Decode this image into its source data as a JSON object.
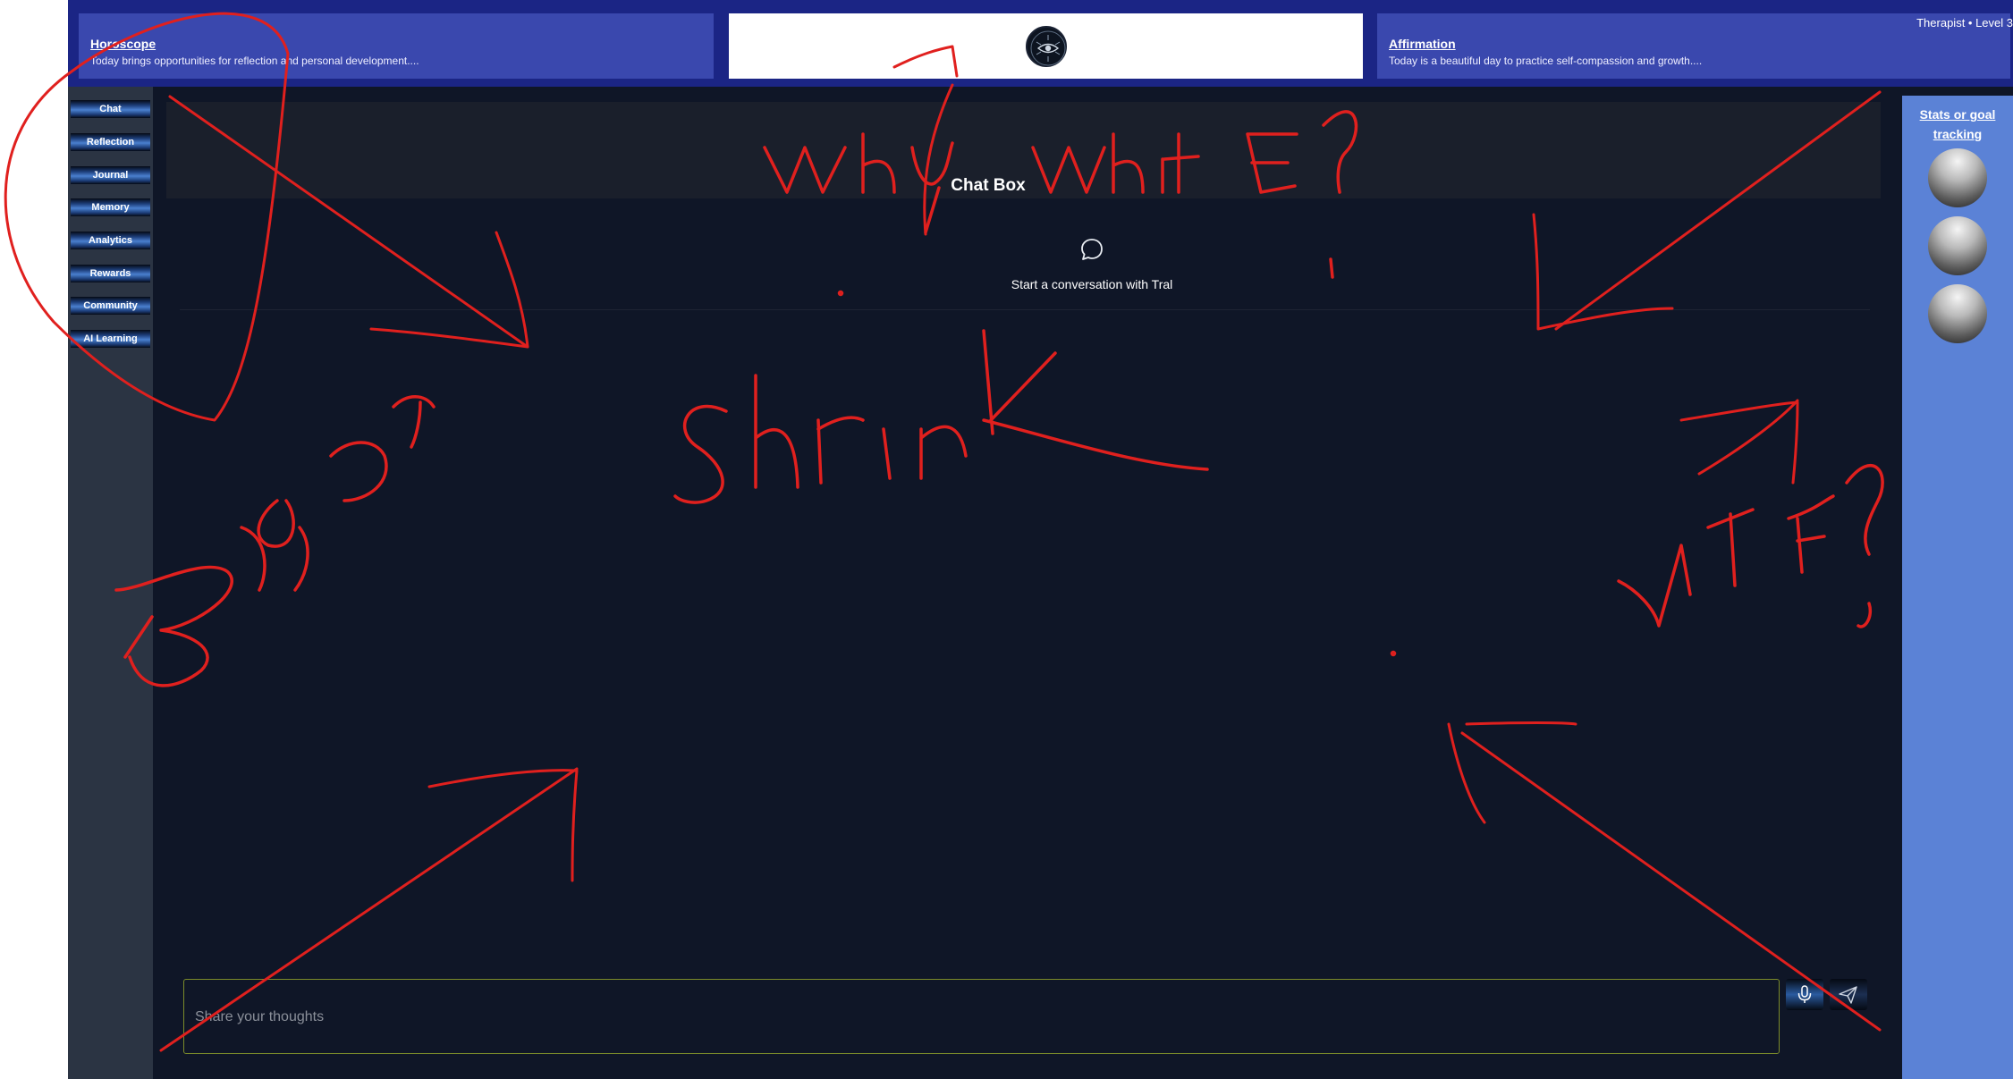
{
  "header": {
    "horoscope": {
      "title": "Horoscope",
      "text": "Today brings opportunities for reflection and personal development...."
    },
    "affirmation": {
      "title": "Affirmation",
      "text": "Today is a beautiful day to practice self-compassion and growth...."
    },
    "user_level": "Therapist • Level 3",
    "logo_icon": "eye-circuit-logo-icon"
  },
  "sidebar": {
    "items": [
      {
        "label": "Chat"
      },
      {
        "label": "Reflection"
      },
      {
        "label": "Journal"
      },
      {
        "label": "Memory"
      },
      {
        "label": "Analytics"
      },
      {
        "label": "Rewards"
      },
      {
        "label": "Community"
      },
      {
        "label": "AI Learning"
      }
    ]
  },
  "chat": {
    "title": "Chat Box",
    "empty_icon": "chat-bubble-icon",
    "empty_text": "Start a conversation with Tral",
    "input_placeholder": "Share your thoughts",
    "mic_icon": "microphone-icon",
    "send_icon": "send-icon"
  },
  "right_panel": {
    "stats_link": "Stats or goal tracking",
    "orbs": [
      "orb-1",
      "orb-2",
      "orb-3"
    ]
  },
  "annotations": {
    "color": "#e0201e",
    "notes": [
      "Why white?",
      "shrink",
      "Bigger",
      "WTF?"
    ]
  }
}
